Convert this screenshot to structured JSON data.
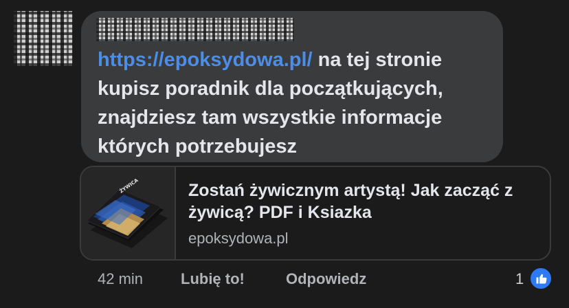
{
  "comment": {
    "link_text": "https://epoksydowa.pl/",
    "text": " na tej stronie kupisz poradnik dla początkujących, znajdziesz tam wszystkie informacje których potrzebujesz"
  },
  "preview": {
    "title": "Zostań żywicznym artystą! Jak zacząć z żywicą? PDF i Ksiazka",
    "domain": "epoksydowa.pl",
    "thumbnail_text": "ŻYWICA"
  },
  "actions": {
    "time": "42 min",
    "like_label": "Lubię to!",
    "reply_label": "Odpowiedz",
    "reaction_count": "1",
    "reaction_icon": "thumbs-up-icon"
  },
  "colors": {
    "background": "#1b1b1c",
    "bubble": "#3a3b3d",
    "link": "#4c8ee7",
    "text": "#e4e6eb",
    "secondary_text": "#b0b3b8",
    "like_blue": "#2d7af3"
  }
}
